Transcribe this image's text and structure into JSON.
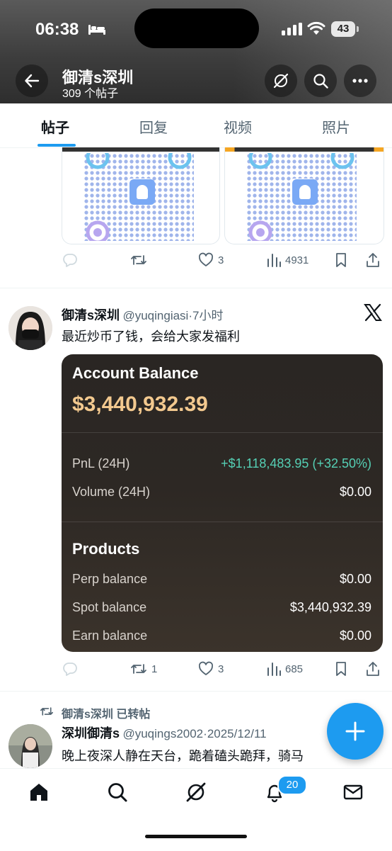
{
  "status_bar": {
    "time": "06:38",
    "battery": "43",
    "icons": [
      "bed-icon",
      "signal-icon",
      "wifi-icon",
      "battery-icon"
    ]
  },
  "header": {
    "profile_name": "御清s深圳",
    "post_count": "309 个帖子",
    "icons": [
      "back-arrow-icon",
      "grok-icon",
      "search-icon",
      "more-icon"
    ]
  },
  "tabs": [
    {
      "label": "帖子",
      "active": true
    },
    {
      "label": "回复",
      "active": false
    },
    {
      "label": "视频",
      "active": false
    },
    {
      "label": "照片",
      "active": false
    }
  ],
  "post1": {
    "actions": {
      "reply": "",
      "retweet": "",
      "like": "3",
      "views": "4931"
    }
  },
  "post2": {
    "author_name": "御清s深圳",
    "handle": "@yuqingiasi",
    "separator": "·",
    "time": "7小时",
    "text": "最近炒币了钱，会给大家发福利",
    "card": {
      "title": "Account Balance",
      "amount": "$3,440,932.39",
      "pnl_label": "PnL (24H)",
      "pnl_value": "+$1,118,483.95 (+32.50%)",
      "volume_label": "Volume (24H)",
      "volume_value": "$0.00",
      "products_title": "Products",
      "perp_label": "Perp balance",
      "perp_value": "$0.00",
      "spot_label": "Spot balance",
      "spot_value": "$3,440,932.39",
      "earn_label": "Earn balance",
      "earn_value": "$0.00"
    },
    "actions": {
      "reply": "",
      "retweet": "1",
      "like": "3",
      "views": "685"
    }
  },
  "post3": {
    "retweet_label": "御清s深圳 已转帖",
    "author_name": "深圳御清s",
    "handle": "@yuqings2002",
    "separator": "·",
    "date": "2025/12/11",
    "text": "晚上夜深人静在天台，跪着磕头跪拜，骑马"
  },
  "bottom_nav": {
    "items": [
      "home-icon",
      "search-icon",
      "grok-icon",
      "notifications-icon",
      "messages-icon"
    ],
    "notification_count": "20"
  },
  "colors": {
    "accent": "#1d9bf0",
    "card_bg": "#2d2824",
    "balance_gold": "#f3c98f",
    "pnl_green": "#55d0b5"
  }
}
